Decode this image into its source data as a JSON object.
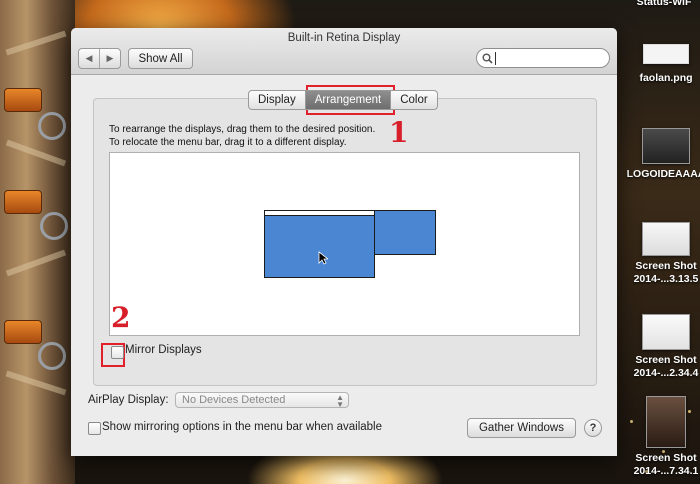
{
  "window": {
    "title": "Built-in Retina Display",
    "nav_back": "◀",
    "nav_forward": "▶",
    "show_all_label": "Show All",
    "search": {
      "value": "",
      "placeholder": ""
    }
  },
  "tabs": [
    {
      "label": "Display"
    },
    {
      "label": "Arrangement",
      "active": true
    },
    {
      "label": "Color"
    }
  ],
  "arrangement": {
    "instruction_line1": "To rearrange the displays, drag them to the desired position.",
    "instruction_line2": "To relocate the menu bar, drag it to a different display.",
    "mirror_label": "Mirror Displays",
    "mirror_checked": false
  },
  "airplay": {
    "label": "AirPlay Display:",
    "selected": "No Devices Detected"
  },
  "mirroring_option_label": "Show mirroring options in the menu bar when available",
  "gather_windows_label": "Gather Windows",
  "help_label": "?",
  "annotations": {
    "one": "1",
    "two": "2"
  },
  "desktop_icons": [
    {
      "label1": "Status-WiF",
      "label2": ""
    },
    {
      "label1": "faolan.png",
      "label2": ""
    },
    {
      "label1": "LOGOIDEAAAA",
      "label2": ""
    },
    {
      "label1": "Screen Shot",
      "label2": "2014-...3.13.5"
    },
    {
      "label1": "Screen Shot",
      "label2": "2014-...2.34.4"
    },
    {
      "label1": "Screen Shot",
      "label2": "2014-...7.34.1"
    }
  ],
  "colors": {
    "display_blue": "#4a86d2",
    "annotation_red": "#e0202a",
    "active_tab": "#7c7c7c"
  }
}
